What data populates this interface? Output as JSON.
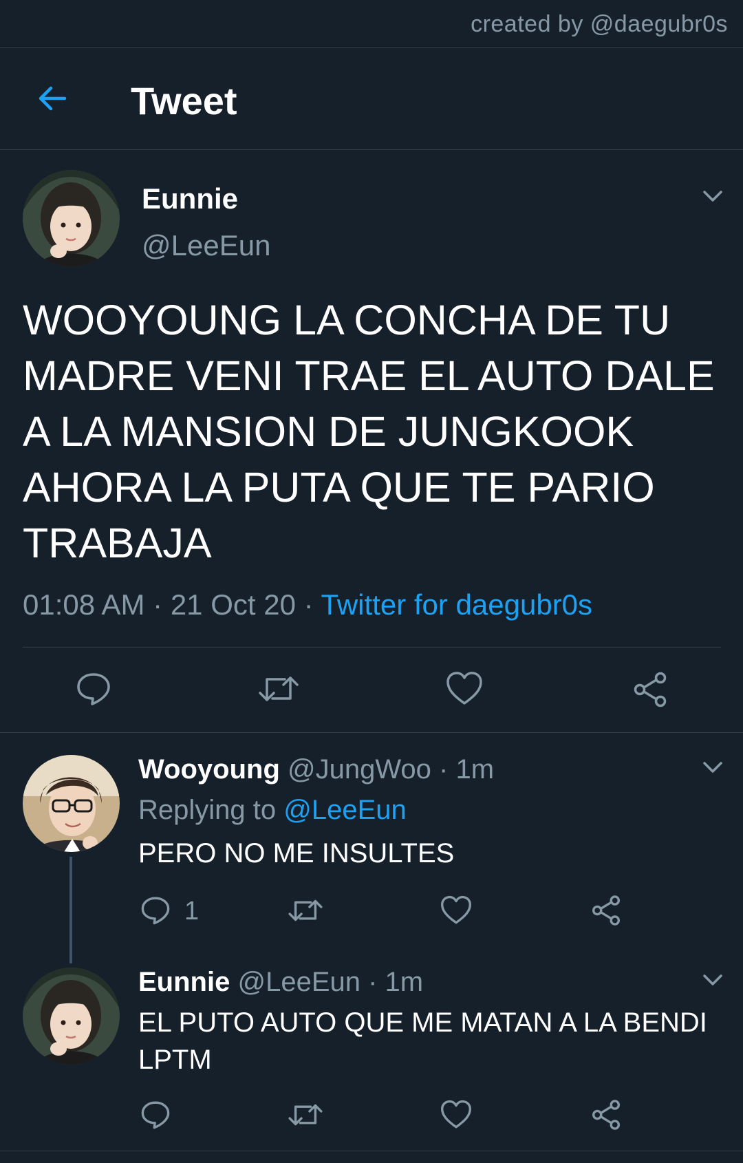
{
  "credit": "created by @daegubr0s",
  "header": {
    "title": "Tweet",
    "back_icon": "arrow-left-icon"
  },
  "colors": {
    "background": "#15202b",
    "accent": "#1da1f2",
    "muted": "#8899a6",
    "divider": "#2f3d4c"
  },
  "main_tweet": {
    "name": "Eunnie",
    "handle": "@LeeEun",
    "text": "WOOYOUNG LA CONCHA DE TU MADRE VENI TRAE EL AUTO DALE A LA MANSION DE JUNGKOOK AHORA LA PUTA QUE TE PARIO TRABAJA",
    "time": "01:08 AM",
    "date": "21 Oct 20",
    "separator": "·",
    "source": "Twitter for daegubr0s"
  },
  "replies": [
    {
      "name": "Wooyoung",
      "handle": "@JungWoo",
      "time": "· 1m",
      "replying_label": "Replying to",
      "replying_handle": "@LeeEun",
      "text": "PERO NO ME INSULTES",
      "reply_count": "1"
    },
    {
      "name": "Eunnie",
      "handle": "@LeeEun",
      "time": "· 1m",
      "text": "EL PUTO AUTO QUE ME MATAN A LA BENDI LPTM"
    }
  ]
}
